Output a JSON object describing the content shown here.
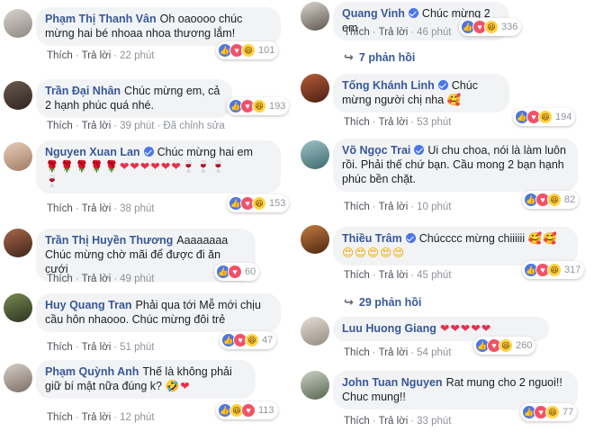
{
  "left": [
    {
      "name": "Phạm Thị Thanh Vân",
      "verified": false,
      "text": "Oh oaoooo chúc mừng hai bé nhoaa nhoa thương lắm!",
      "like": "Thích",
      "reply": "Trả lời",
      "time": "22 phút",
      "reactions": "101"
    },
    {
      "name": "Trần Đại Nhân",
      "verified": false,
      "text": "Chúc mừng em, cả 2 hạnh phúc quá nhé.",
      "like": "Thích",
      "reply": "Trả lời",
      "time": "39 phút",
      "edited": "Đã chỉnh sửa",
      "reactions": "193"
    },
    {
      "name": "Nguyen Xuan Lan",
      "verified": true,
      "text": "Chúc mừng hai em",
      "like": "Thích",
      "reply": "Trả lời",
      "time": "38 phút",
      "reactions": "153"
    },
    {
      "name": "Trần Thị Huyền Thương",
      "verified": false,
      "text": "Aaaaaaaa Chúc mừng chờ mãi để được đi ăn cưới",
      "like": "Thích",
      "reply": "Trả lời",
      "time": "49 phút",
      "reactions": "60"
    },
    {
      "name": "Huy Quang Tran",
      "verified": false,
      "text": "Phải qua tới Mễ mới chịu cầu hôn nhaooo. Chúc mừng đôi trẻ",
      "like": "Thích",
      "reply": "Trả lời",
      "time": "51 phút",
      "reactions": "47"
    },
    {
      "name": "Phạm Quỳnh Anh",
      "verified": false,
      "text": "Thế là không phải giữ bí mật nữa đúng k?",
      "like": "Thích",
      "reply": "Trả lời",
      "time": "12 phút",
      "reactions": "113"
    }
  ],
  "right": [
    {
      "name": "Quang Vinh",
      "verified": true,
      "text": "Chúc mừng 2 em",
      "like": "Thích",
      "reply": "Trả lời",
      "time": "46 phút",
      "reactions": "336",
      "replies": "7 phản hồi"
    },
    {
      "name": "Tống Khánh Linh",
      "verified": true,
      "text": "Chúc mừng người chị nha",
      "like": "Thích",
      "reply": "Trả lời",
      "time": "53 phút",
      "reactions": "194"
    },
    {
      "name": "Võ Ngọc Trai",
      "verified": true,
      "text": "Ui chu choa, nói là làm luôn rồi. Phải thế chứ bạn. Cầu mong 2 bạn hạnh phúc bền chặt.",
      "like": "Thích",
      "reply": "Trả lời",
      "time": "10 phút",
      "reactions": "82"
    },
    {
      "name": "Thiều Trâm",
      "verified": true,
      "text": "Chúcccc mừng chiiiiii",
      "like": "Thích",
      "reply": "Trả lời",
      "time": "45 phút",
      "reactions": "317",
      "replies": "29 phản hồi"
    },
    {
      "name": "Luu Huong Giang",
      "verified": false,
      "text": "",
      "like": "Thích",
      "reply": "Trả lời",
      "time": "54 phút",
      "reactions": "260"
    },
    {
      "name": "John Tuan Nguyen",
      "verified": false,
      "text": "Rat mung cho 2 nguoi!! Chuc mung!!",
      "like": "Thích",
      "reply": "Trả lời",
      "time": "33 phút",
      "reactions": "77"
    }
  ],
  "colors": {
    "name": "#385898",
    "bubble": "#f2f3f5",
    "like": "#4a76e8",
    "love": "#f25268",
    "haha": "#ffd340"
  }
}
